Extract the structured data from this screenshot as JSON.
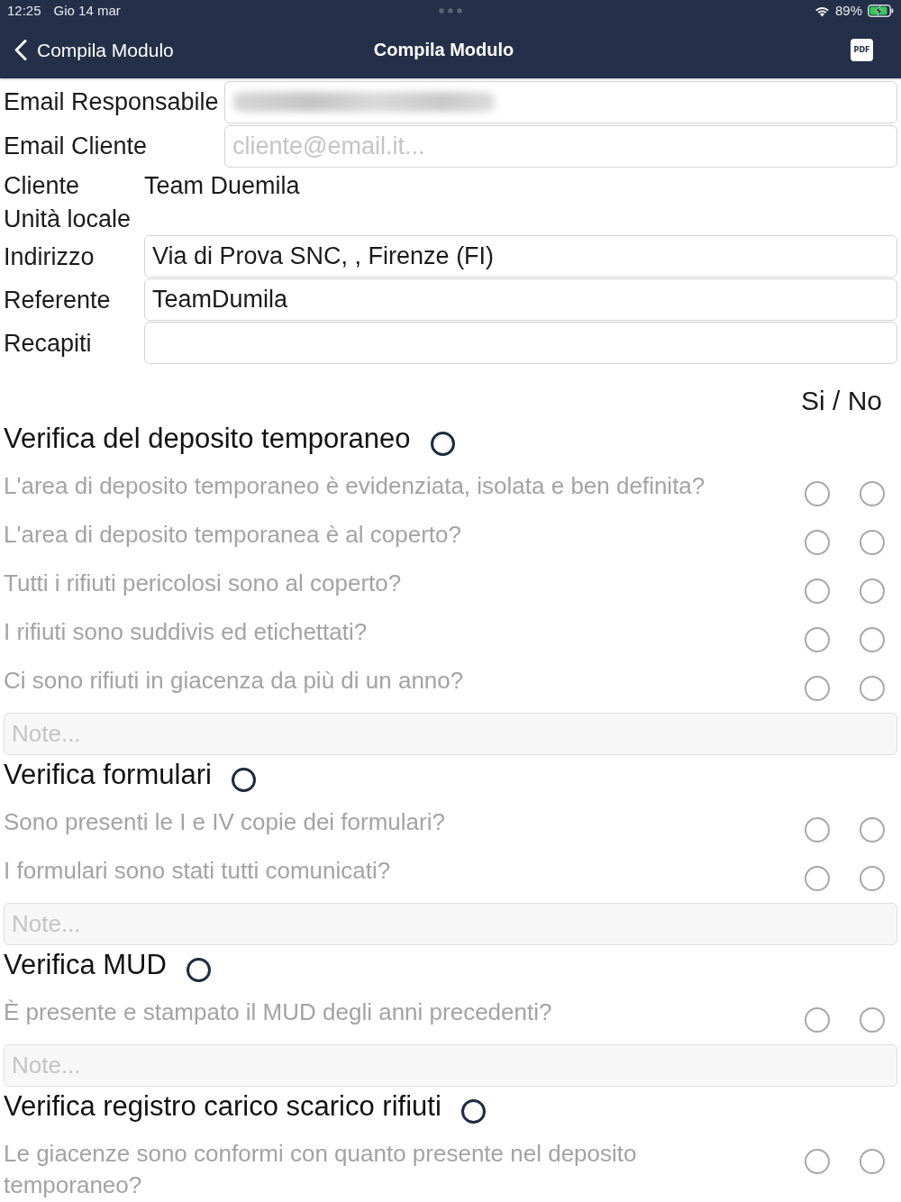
{
  "status_bar": {
    "time": "12:25",
    "date": "Gio 14 mar",
    "battery": "89%"
  },
  "nav_bar": {
    "back_label": "Compila Modulo",
    "title": "Compila Modulo",
    "pdf_label": "PDF"
  },
  "email_fields": [
    {
      "label": "Email Responsabile",
      "redacted": true
    },
    {
      "label": "Email Cliente",
      "placeholder": "cliente@email.it...",
      "redacted": false
    }
  ],
  "client_fields": [
    {
      "kind": "text",
      "label": "Cliente",
      "value": "Team Duemila"
    },
    {
      "kind": "label",
      "label": "Unità locale"
    },
    {
      "kind": "input",
      "label": "Indirizzo",
      "value": "Via di Prova SNC, , Firenze (FI)"
    },
    {
      "kind": "input",
      "label": "Referente",
      "value": "TeamDumila"
    },
    {
      "kind": "input",
      "label": "Recapiti"
    }
  ],
  "answer_header": "Si / No",
  "sections": [
    {
      "title": "Verifica del deposito temporaneo",
      "completed": false,
      "questions": [
        {
          "text": "L'area di deposito temporaneo è evidenziata, isolata e ben definita?",
          "yes_checked": false,
          "no_checked": false
        },
        {
          "text": "L'area di deposito temporanea è al coperto?",
          "yes_checked": false,
          "no_checked": false
        },
        {
          "text": "Tutti i rifiuti pericolosi sono al coperto?",
          "yes_checked": false,
          "no_checked": false
        },
        {
          "text": "I rifiuti sono suddivis ed etichettati?",
          "yes_checked": false,
          "no_checked": false
        },
        {
          "text": "Ci sono rifiuti in giacenza da più di un anno?",
          "yes_checked": false,
          "no_checked": false
        }
      ],
      "note": {
        "placeholder": "Note..."
      }
    },
    {
      "title": "Verifica formulari",
      "completed": false,
      "questions": [
        {
          "text": "Sono presenti le I e IV copie dei formulari?",
          "yes_checked": false,
          "no_checked": false
        },
        {
          "text": "I formulari sono stati tutti comunicati?",
          "yes_checked": false,
          "no_checked": false
        }
      ],
      "note": {
        "placeholder": "Note..."
      }
    },
    {
      "title": "Verifica MUD",
      "completed": false,
      "questions": [
        {
          "text": "È presente e stampato il MUD degli anni precedenti?",
          "yes_checked": false,
          "no_checked": false
        }
      ],
      "note": {
        "placeholder": "Note..."
      }
    },
    {
      "title": "Verifica registro carico scarico rifiuti",
      "completed": false,
      "questions": [
        {
          "text": "Le giacenze sono conformi con quanto presente nel deposito temporaneo?",
          "yes_checked": false,
          "no_checked": false
        }
      ]
    }
  ]
}
